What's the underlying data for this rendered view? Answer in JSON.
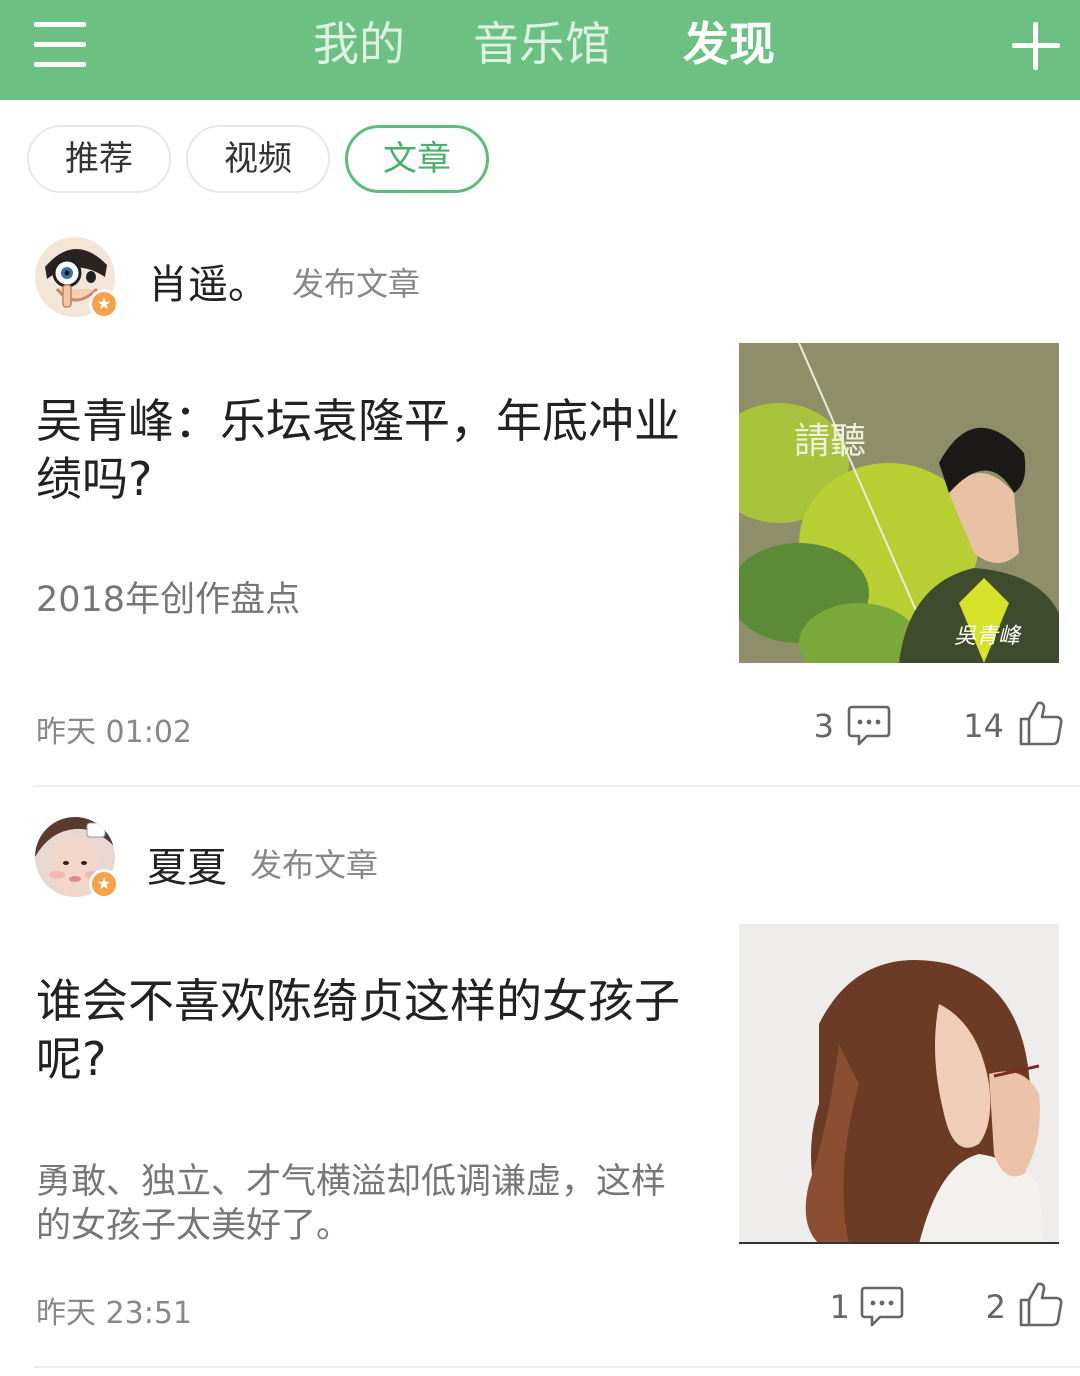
{
  "top_nav": {
    "tabs": [
      {
        "label": "我的"
      },
      {
        "label": "音乐馆"
      },
      {
        "label": "发现"
      }
    ],
    "active_tab": "发现",
    "menu_icon": "menu-icon",
    "add_icon": "plus-icon"
  },
  "filter_chips": [
    {
      "label": "推荐"
    },
    {
      "label": "视频"
    },
    {
      "label": "文章"
    }
  ],
  "active_chip": "文章",
  "posts": [
    {
      "author": "肖遥。",
      "action": "发布文章",
      "title": "吴青峰：乐坛袁隆平，年底冲业绩吗?",
      "summary": "2018年创作盘点",
      "time": "昨天 01:02",
      "comments": "3",
      "likes": "14",
      "thumb_text": "請聽",
      "thumb_signature": "吳青峰"
    },
    {
      "author": "夏夏",
      "action": "发布文章",
      "title": "谁会不喜欢陈绮贞这样的女孩子呢?",
      "summary": "勇敢、独立、才气横溢却低调谦虚，这样的女孩子太美好了。",
      "time": "昨天 23:51",
      "comments": "1",
      "likes": "2"
    }
  ],
  "colors": {
    "brand_green": "#6cc082",
    "chip_active": "#4bb06b",
    "badge_orange": "#f4a24c"
  }
}
